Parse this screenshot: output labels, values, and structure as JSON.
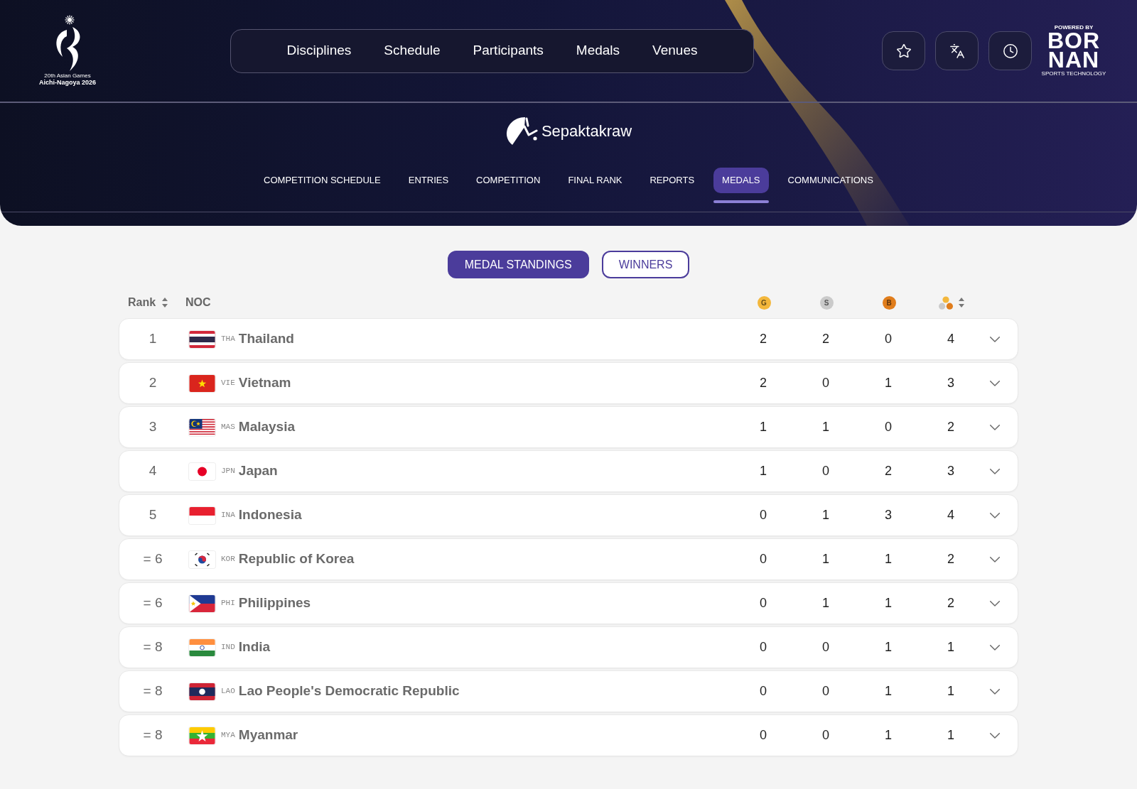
{
  "header": {
    "games_logo": {
      "edition": "20th Asian Games",
      "name": "Aichi-Nagoya 2026"
    },
    "nav": [
      "Disciplines",
      "Schedule",
      "Participants",
      "Medals",
      "Venues"
    ],
    "sponsor": {
      "powered_by": "POWERED BY",
      "wordmark_lines": [
        "BOR",
        "NAN"
      ],
      "tagline": "SPORTS TECHNOLOGY"
    }
  },
  "sport": {
    "name": "Sepaktakraw",
    "tabs": [
      {
        "label": "COMPETITION SCHEDULE",
        "selected": false
      },
      {
        "label": "ENTRIES",
        "selected": false
      },
      {
        "label": "COMPETITION",
        "selected": false
      },
      {
        "label": "FINAL RANK",
        "selected": false
      },
      {
        "label": "REPORTS",
        "selected": false
      },
      {
        "label": "MEDALS",
        "selected": true
      },
      {
        "label": "COMMUNICATIONS",
        "selected": false
      }
    ]
  },
  "view_toggle": [
    {
      "label": "MEDAL STANDINGS",
      "selected": true
    },
    {
      "label": "WINNERS",
      "selected": false
    }
  ],
  "table": {
    "columns": [
      {
        "kind": "rank",
        "label": "Rank",
        "sortable": true
      },
      {
        "kind": "noc",
        "label": "NOC",
        "sortable": false
      },
      {
        "kind": "medal",
        "label": "G",
        "color": "#f3b73c",
        "sortable": false
      },
      {
        "kind": "medal",
        "label": "S",
        "color": "#cacaca",
        "sortable": false
      },
      {
        "kind": "medal",
        "label": "B",
        "color": "#e07d1c",
        "sortable": false
      },
      {
        "kind": "total",
        "sortable": true
      }
    ],
    "rows": [
      {
        "rank": "1",
        "kind": "thailand",
        "code": "THA",
        "name": "Thailand",
        "medals": [
          "2",
          "2",
          "0"
        ],
        "total": "4",
        "expanded": false
      },
      {
        "rank": "2",
        "kind": "vietnam",
        "code": "VIE",
        "name": "Vietnam",
        "medals": [
          "2",
          "0",
          "1"
        ],
        "total": "3",
        "expanded": false
      },
      {
        "rank": "3",
        "kind": "malaysia",
        "code": "MAS",
        "name": "Malaysia",
        "medals": [
          "1",
          "1",
          "0"
        ],
        "total": "2",
        "expanded": false
      },
      {
        "rank": "4",
        "kind": "japan",
        "code": "JPN",
        "name": "Japan",
        "medals": [
          "1",
          "0",
          "2"
        ],
        "total": "3",
        "expanded": false
      },
      {
        "rank": "5",
        "kind": "indonesia",
        "code": "INA",
        "name": "Indonesia",
        "medals": [
          "0",
          "1",
          "3"
        ],
        "total": "4",
        "expanded": false
      },
      {
        "rank": "= 6",
        "kind": "korea",
        "code": "KOR",
        "name": "Republic of Korea",
        "medals": [
          "0",
          "1",
          "1"
        ],
        "total": "2",
        "expanded": false
      },
      {
        "rank": "= 6",
        "kind": "philippines",
        "code": "PHI",
        "name": "Philippines",
        "medals": [
          "0",
          "1",
          "1"
        ],
        "total": "2",
        "expanded": false
      },
      {
        "rank": "= 8",
        "kind": "india",
        "code": "IND",
        "name": "India",
        "medals": [
          "0",
          "0",
          "1"
        ],
        "total": "1",
        "expanded": false
      },
      {
        "rank": "= 8",
        "kind": "laos",
        "code": "LAO",
        "name": "Lao People's Democratic Republic",
        "medals": [
          "0",
          "0",
          "1"
        ],
        "total": "1",
        "expanded": false
      },
      {
        "rank": "= 8",
        "kind": "myanmar",
        "code": "MYA",
        "name": "Myanmar",
        "medals": [
          "0",
          "0",
          "1"
        ],
        "total": "1",
        "expanded": false
      }
    ]
  }
}
